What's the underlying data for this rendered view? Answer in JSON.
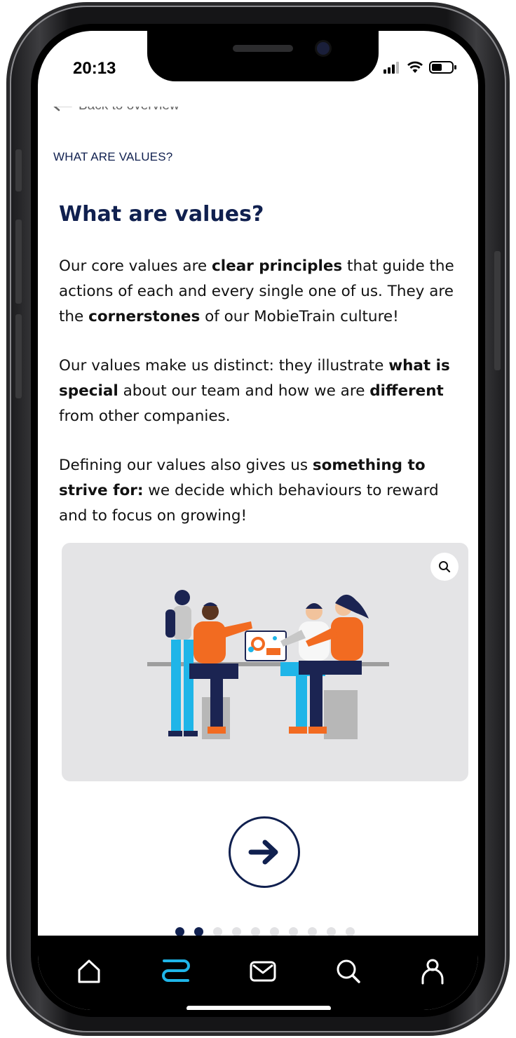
{
  "status_bar": {
    "time": "20:13"
  },
  "nav": {
    "back_label": "Back to overview"
  },
  "section_label": "WHAT ARE VALUES?",
  "article": {
    "title": "What are values?",
    "p1": {
      "t1": "Our core values are ",
      "b1": "clear principles",
      "t2": " that guide the actions of each and every single one of us. They are the ",
      "b2": "cornerstones",
      "t3": " of our MobieTrain culture!"
    },
    "p2": {
      "t1": "Our values make us distinct: they illustrate ",
      "b1": "what is special",
      "t2": " about our team and how we are ",
      "b2": "different",
      "t3": " from other companies."
    },
    "p3": {
      "t1": "Defining our values also gives us ",
      "b1": "something to strive for:",
      "t2": " we decide which behaviours to reward and to focus on growing!"
    }
  },
  "image": {
    "icon": "team-meeting-illustration",
    "zoom_icon": "zoom-icon"
  },
  "pagination": {
    "current": 2,
    "total": 10
  },
  "tabbar": {
    "items": [
      "home-icon",
      "learning-path-icon",
      "inbox-icon",
      "search-icon",
      "profile-icon"
    ],
    "active": "learning-path-icon"
  },
  "colors": {
    "navy": "#10204f",
    "accent": "#1fb5e8",
    "orange": "#f26b21",
    "card": "#e4e4e6"
  }
}
